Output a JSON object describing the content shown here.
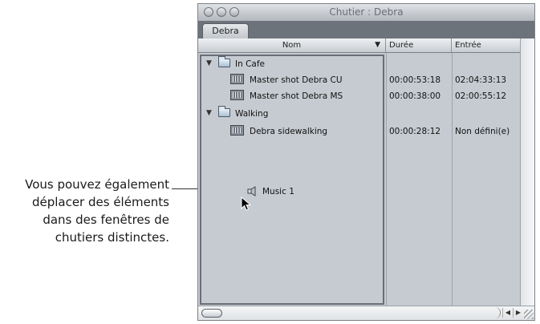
{
  "callout": {
    "lines": [
      "Vous pouvez également",
      "déplacer des éléments",
      "dans des fenêtres de",
      "chutiers distinctes."
    ]
  },
  "window": {
    "title": "Chutier : Debra",
    "tab": "Debra"
  },
  "columns": {
    "name": "Nom",
    "duration": "Durée",
    "in": "Entrée"
  },
  "rows": [
    {
      "type": "folder",
      "name": "In Cafe",
      "duration": "",
      "in": ""
    },
    {
      "type": "clip",
      "name": "Master shot Debra CU",
      "duration": "00:00:53:18",
      "in": "02:04:33:13"
    },
    {
      "type": "clip",
      "name": "Master shot Debra MS",
      "duration": "00:00:38:00",
      "in": "02:00:55:12"
    },
    {
      "type": "folder",
      "name": "Walking",
      "duration": "",
      "in": ""
    },
    {
      "type": "clip",
      "name": "Debra sidewalking",
      "duration": "00:00:28:12",
      "in": "Non défini(e)"
    }
  ],
  "dragged_item": {
    "name": "Music 1",
    "icon": "audio-clip-icon"
  }
}
